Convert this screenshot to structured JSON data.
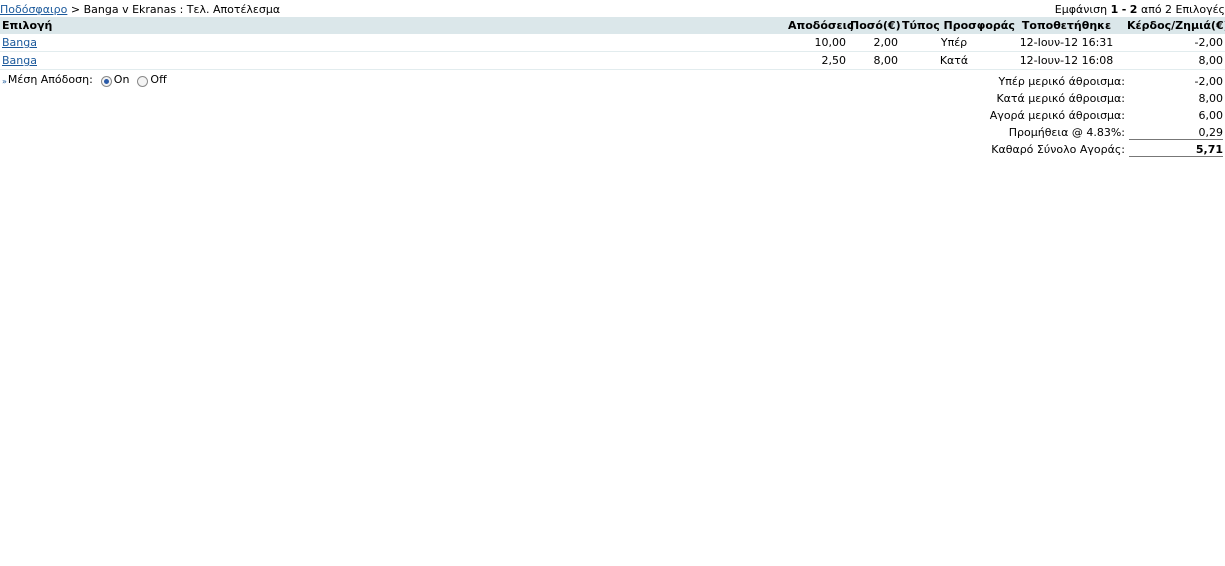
{
  "breadcrumb": {
    "link": "Ποδόσφαιρο",
    "rest": "> Banga v Ekranas : Τελ. Αποτέλεσμα"
  },
  "paging": {
    "prefix": "Εμφάνιση",
    "from": "1",
    "dash": "-",
    "to": "2",
    "suffix": "από 2 Επιλογές"
  },
  "table": {
    "headers": [
      "Επιλογή",
      "Αποδόσεις",
      "Ποσό(€)",
      "Τύπος Προσφοράς",
      "Τοποθετήθηκε",
      "Κέρδος/Ζημιά(€)"
    ],
    "rows": [
      {
        "selection": "Banga",
        "odds": "10,00",
        "stake": "2,00",
        "type": "Υπέρ",
        "placed": "12-Ιουν-12 16:31",
        "pl": "-2,00"
      },
      {
        "selection": "Banga",
        "odds": "2,50",
        "stake": "8,00",
        "type": "Κατά",
        "placed": "12-Ιουν-12 16:08",
        "pl": "8,00"
      }
    ]
  },
  "average_odds": {
    "marker": "»",
    "label": "Μέση Απόδοση:",
    "on_label": "On",
    "off_label": "Off",
    "selected": "On"
  },
  "summary": [
    {
      "label": "Υπέρ μερικό άθροισμα:",
      "value": "-2,00"
    },
    {
      "label": "Κατά μερικό άθροισμα:",
      "value": "8,00"
    },
    {
      "label": "Αγορά μερικό άθροισμα:",
      "value": "6,00"
    },
    {
      "label": "Προμήθεια @ 4.83%:",
      "value": "0,29"
    },
    {
      "label": "Καθαρό Σύνολο Αγοράς:",
      "value": "5,71"
    }
  ],
  "colors": {
    "header_bg": "#dbe7ea",
    "link": "#1c5a9c"
  }
}
